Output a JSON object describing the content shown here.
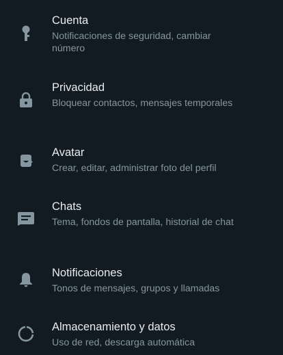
{
  "settings": {
    "items": [
      {
        "title": "Cuenta",
        "description": "Notificaciones de seguridad, cambiar número",
        "icon": "key-icon"
      },
      {
        "title": "Privacidad",
        "description": "Bloquear contactos, mensajes temporales",
        "icon": "lock-icon"
      },
      {
        "title": "Avatar",
        "description": "Crear, editar, administrar foto del perfil",
        "icon": "avatar-icon"
      },
      {
        "title": "Chats",
        "description": "Tema, fondos de pantalla, historial de chat",
        "icon": "chat-icon"
      },
      {
        "title": "Notificaciones",
        "description": "Tonos de mensajes, grupos y llamadas",
        "icon": "bell-icon"
      },
      {
        "title": "Almacenamiento y datos",
        "description": "Uso de red, descarga automática",
        "icon": "data-usage-icon"
      }
    ]
  },
  "colors": {
    "background": "#111b21",
    "title": "#e9edef",
    "description": "#8696a0",
    "icon": "#8696a0"
  }
}
